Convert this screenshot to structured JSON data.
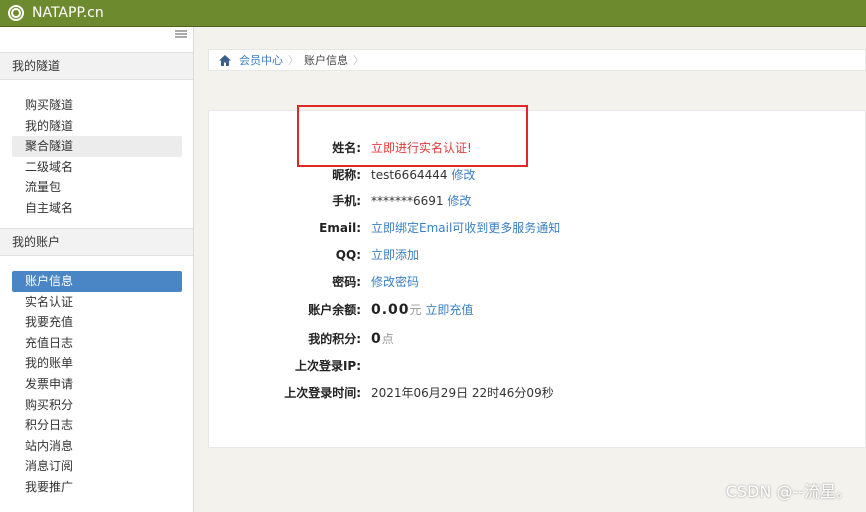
{
  "topbar": {
    "brand": "NATAPP.cn"
  },
  "sidebar": {
    "tunnels_header": "我的隧道",
    "tunnels": [
      {
        "label": "购买隧道",
        "state": "normal"
      },
      {
        "label": "我的隧道",
        "state": "normal"
      },
      {
        "label": "聚合隧道",
        "state": "hover"
      },
      {
        "label": "二级域名",
        "state": "normal"
      },
      {
        "label": "流量包",
        "state": "normal"
      },
      {
        "label": "自主域名",
        "state": "normal"
      }
    ],
    "account_header": "我的账户",
    "account": [
      {
        "label": "账户信息",
        "state": "active"
      },
      {
        "label": "实名认证",
        "state": "normal"
      },
      {
        "label": "我要充值",
        "state": "normal"
      },
      {
        "label": "充值日志",
        "state": "normal"
      },
      {
        "label": "我的账单",
        "state": "normal"
      },
      {
        "label": "发票申请",
        "state": "normal"
      },
      {
        "label": "购买积分",
        "state": "normal"
      },
      {
        "label": "积分日志",
        "state": "normal"
      },
      {
        "label": "站内消息",
        "state": "normal"
      },
      {
        "label": "消息订阅",
        "state": "normal"
      },
      {
        "label": "我要推广",
        "state": "normal"
      }
    ]
  },
  "breadcrumb": {
    "home": "会员中心",
    "current": "账户信息"
  },
  "info": {
    "name_label": "姓名:",
    "name_action": "立即进行实名认证!",
    "nick_label": "昵称:",
    "nick_value": "test6664444",
    "nick_edit": "修改",
    "phone_label": "手机:",
    "phone_value": "*******6691",
    "phone_edit": "修改",
    "email_label": "Email:",
    "email_action": "立即绑定Email可收到更多服务通知",
    "qq_label": "QQ:",
    "qq_action": "立即添加",
    "password_label": "密码:",
    "password_action": "修改密码",
    "balance_label": "账户余额:",
    "balance_value": "0.00",
    "balance_unit": "元",
    "balance_action": "立即充值",
    "points_label": "我的积分:",
    "points_value": "0",
    "points_unit": "点",
    "last_ip_label": "上次登录IP:",
    "last_ip_value": "",
    "last_time_label": "上次登录时间:",
    "last_time_value": "2021年06月29日 22时46分09秒"
  },
  "watermark": "CSDN @--流星。",
  "colors": {
    "topbar": "#6d8a2e",
    "active": "#4a86c5",
    "link": "#3a7fc2",
    "alert": "#e03a3a"
  }
}
